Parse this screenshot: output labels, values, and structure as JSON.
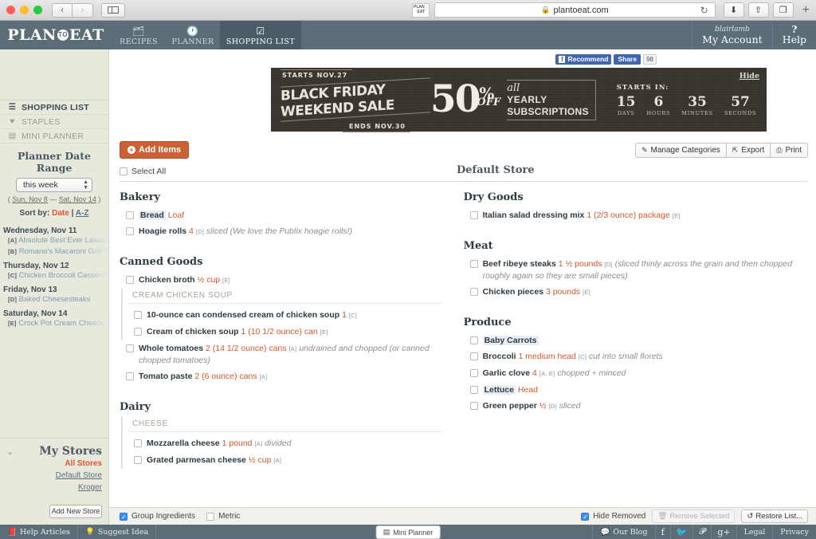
{
  "browser": {
    "url": "plantoeat.com",
    "lock_icon": "lock-icon",
    "back_icon": "‹",
    "forward_icon": "›",
    "reload_icon": "↻",
    "site_icon_top": "PLAN→",
    "site_icon_bottom": "EAT",
    "download_icon": "⬇",
    "share_icon": "⇧",
    "tabs_icon": "❐",
    "new_tab_icon": "+"
  },
  "header": {
    "logo_left": "PLAN",
    "logo_mark": "TO",
    "logo_right": "EAT",
    "nav": [
      {
        "label": "RECIPES",
        "icon": "recipes-icon",
        "glyph": "🗂",
        "active": false
      },
      {
        "label": "PLANNER",
        "icon": "clock-icon",
        "glyph": "🕐",
        "active": false
      },
      {
        "label": "SHOPPING LIST",
        "icon": "checklist-icon",
        "glyph": "☑",
        "active": true
      }
    ],
    "username": "blairlamb",
    "account_label": "My Account",
    "help_mark": "?",
    "help_label": "Help"
  },
  "social": {
    "recommend_label": "Recommend",
    "facebook_glyph": "f",
    "share_label": "Share",
    "share_count": "98"
  },
  "ad": {
    "hide_label": "Hide",
    "starts_date": "STARTS NOV.27",
    "title": "BLACK FRIDAY WEEKEND SALE",
    "ends_date": "ENDS NOV.30",
    "percent": "50",
    "percent_sign": "%",
    "off": "OFF",
    "all": "all",
    "yearly": "YEARLY",
    "subscriptions": "SUBSCRIPTIONS",
    "starts_in_label": "STARTS IN:",
    "countdown": [
      {
        "value": "15",
        "label": "DAYS"
      },
      {
        "value": "6",
        "label": "HOURS"
      },
      {
        "value": "35",
        "label": "MINUTES"
      },
      {
        "value": "57",
        "label": "SECONDS"
      }
    ]
  },
  "sidebar": {
    "nav": [
      {
        "label": "SHOPPING LIST",
        "icon": "list-icon",
        "glyph": "☰",
        "active": true
      },
      {
        "label": "STAPLES",
        "icon": "heart-icon",
        "glyph": "♥",
        "active": false
      },
      {
        "label": "MINI PLANNER",
        "icon": "calendar-icon",
        "glyph": "▤",
        "active": false
      }
    ],
    "planner_title": "Planner Date Range",
    "range_select_value": "this week",
    "range_text_open": "(",
    "range_start": "Sun, Nov 8",
    "range_dash": "—",
    "range_end": "Sat, Nov 14",
    "range_text_close": ")",
    "sort_label": "Sort by:",
    "sort_date": "Date",
    "sort_sep": "|",
    "sort_az": "A-Z",
    "days": [
      {
        "day": "Wednesday, Nov 11",
        "recipes": [
          {
            "tag": "[A]",
            "name": "Absolute Best Ever Lasagna"
          },
          {
            "tag": "[B]",
            "name": "Romano's Macaroni Grill Ro"
          }
        ]
      },
      {
        "day": "Thursday, Nov 12",
        "recipes": [
          {
            "tag": "[C]",
            "name": "Chicken Broccoli Casserole"
          }
        ]
      },
      {
        "day": "Friday, Nov 13",
        "recipes": [
          {
            "tag": "[D]",
            "name": "Baked Cheesesteaks"
          }
        ]
      },
      {
        "day": "Saturday, Nov 14",
        "recipes": [
          {
            "tag": "[E]",
            "name": "Crock Pot Cream Cheese C"
          }
        ]
      }
    ],
    "stores_title": "My Stores",
    "stores": [
      {
        "label": "All Stores",
        "selected": true
      },
      {
        "label": "Default Store",
        "selected": false
      },
      {
        "label": "Kroger",
        "selected": false
      }
    ],
    "add_store_label": "Add New Store",
    "collapse_icon": "chevron-down-icon"
  },
  "toolbar": {
    "add_items_label": "Add Items",
    "manage_categories_label": "Manage Categories",
    "manage_categories_icon": "pencil-icon",
    "export_label": "Export",
    "export_icon": "export-icon",
    "print_label": "Print",
    "print_icon": "printer-icon"
  },
  "list": {
    "select_all_label": "Select All",
    "store_heading": "Default Store",
    "left_categories": [
      {
        "name": "Bakery",
        "items": [
          {
            "name": "Bread",
            "highlight": true,
            "qty": "Loaf",
            "tag": "",
            "note": ""
          },
          {
            "name": "Hoagie rolls",
            "highlight": false,
            "qty": "4",
            "tag": "[D]",
            "note": "sliced (We love the Publix hoagie rolls!)"
          }
        ],
        "subgroups": []
      },
      {
        "name": "Canned Goods",
        "items": [
          {
            "name": "Chicken broth",
            "highlight": false,
            "qty": "½ cup",
            "tag": "[E]",
            "note": ""
          }
        ],
        "subgroups": [
          {
            "label": "CREAM CHICKEN SOUP",
            "items": [
              {
                "name": "10-ounce can condensed cream of chicken soup",
                "highlight": false,
                "qty": "1",
                "tag": "[C]",
                "note": ""
              },
              {
                "name": "Cream of chicken soup",
                "highlight": false,
                "qty": "1 (10 1/2 ounce) can",
                "tag": "[E]",
                "note": ""
              }
            ]
          }
        ],
        "after_items": [
          {
            "name": "Whole tomatoes",
            "highlight": false,
            "qty": "2 (14 1/2 ounce) cans",
            "tag": "[A]",
            "note": "undrained and chopped (or canned chopped tomatoes)"
          },
          {
            "name": "Tomato paste",
            "highlight": false,
            "qty": "2 (6 ounce) cans",
            "tag": "[A]",
            "note": ""
          }
        ]
      },
      {
        "name": "Dairy",
        "items": [],
        "subgroups": [
          {
            "label": "CHEESE",
            "items": [
              {
                "name": "Mozzarella cheese",
                "highlight": false,
                "qty": "1 pound",
                "tag": "[A]",
                "note": "divided"
              },
              {
                "name": "Grated parmesan cheese",
                "highlight": false,
                "qty": "½ cup",
                "tag": "[A]",
                "note": ""
              }
            ]
          }
        ],
        "after_items": []
      }
    ],
    "right_categories": [
      {
        "name": "Dry Goods",
        "items": [
          {
            "name": "Italian salad dressing mix",
            "highlight": false,
            "qty": "1 (2/3 ounce) package",
            "tag": "[E]",
            "note": ""
          }
        ]
      },
      {
        "name": "Meat",
        "items": [
          {
            "name": "Beef ribeye steaks",
            "highlight": false,
            "qty": "1 ½ pounds",
            "tag": "[D]",
            "note": "(sliced thinly across the grain and then chopped roughly again so they are small pieces)"
          },
          {
            "name": "Chicken pieces",
            "highlight": false,
            "qty": "3 pounds",
            "tag": "[E]",
            "note": ""
          }
        ]
      },
      {
        "name": "Produce",
        "items": [
          {
            "name": "Baby Carrots",
            "highlight": true,
            "qty": "",
            "tag": "",
            "note": ""
          },
          {
            "name": "Broccoli",
            "highlight": false,
            "qty": "1 medium head",
            "tag": "[C]",
            "note": "cut into small florets"
          },
          {
            "name": "Garlic clove",
            "highlight": false,
            "qty": "4",
            "tag": "[A, E]",
            "note": "chopped + minced"
          },
          {
            "name": "Lettuce",
            "highlight": true,
            "qty": "Head",
            "tag": "",
            "note": ""
          },
          {
            "name": "Green pepper",
            "highlight": false,
            "qty": "½",
            "tag": "[D]",
            "note": "sliced"
          }
        ]
      }
    ]
  },
  "options": {
    "group_ingredients_label": "Group Ingredients",
    "group_ingredients_checked": true,
    "metric_label": "Metric",
    "metric_checked": false,
    "hide_removed_label": "Hide Removed",
    "hide_removed_checked": true,
    "remove_selected_label": "Remove Selected",
    "remove_selected_icon": "trash-icon",
    "restore_list_label": "Restore List...",
    "restore_list_icon": "history-icon"
  },
  "footer": {
    "help_articles_label": "Help Articles",
    "help_articles_icon": "book-icon",
    "suggest_idea_label": "Suggest Idea",
    "suggest_idea_icon": "lightbulb-icon",
    "mini_planner_label": "Mini Planner",
    "mini_planner_icon": "calendar-icon",
    "our_blog_label": "Our Blog",
    "our_blog_icon": "comment-icon",
    "facebook_icon": "facebook-icon",
    "twitter_icon": "twitter-icon",
    "pinterest_icon": "pinterest-icon",
    "googleplus_icon": "google-plus-icon",
    "legal_label": "Legal",
    "privacy_label": "Privacy"
  },
  "colors": {
    "header": "#5b6e78",
    "accent_orange": "#cb6237",
    "qty_orange": "#d4572a",
    "sidebar_bg": "#e8e8dc",
    "ad_bg": "#3a352e"
  }
}
